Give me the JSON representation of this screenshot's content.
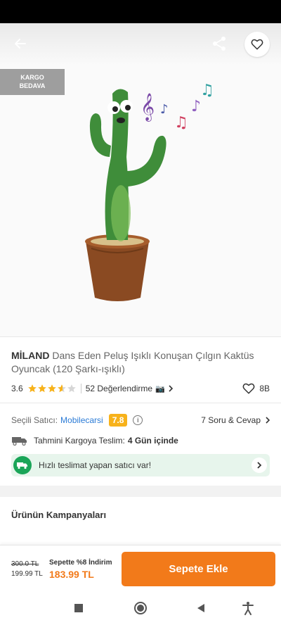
{
  "badge": {
    "line1": "KARGO",
    "line2": "BEDAVA"
  },
  "product": {
    "brand": "MİLAND",
    "name": "Dans Eden Peluş Işıklı Konuşan Çılgın Kaktüs Oyuncak (120 Şarkı-ışıklı)"
  },
  "rating": {
    "value": "3.6",
    "stars_filled": 3.6,
    "stars_total": 5,
    "reviews": "52 Değerlendirme",
    "favorites": "8B"
  },
  "seller": {
    "label": "Seçili Satıcı:",
    "name": "Mobilecarsi",
    "score": "7.8",
    "qa": "7 Soru & Cevap"
  },
  "shipping": {
    "label": "Tahmini Kargoya Teslim:",
    "value": "4 Gün içinde",
    "fast_text": "Hızlı teslimat yapan satıcı var!"
  },
  "campaigns": {
    "title": "Ürünün Kampanyaları"
  },
  "price": {
    "old": "300.0 TL",
    "list": "199.99 TL",
    "cart_discount": "Sepette %8 İndirim",
    "final": "183.99 TL",
    "add_to_cart": "Sepete Ekle"
  },
  "colors": {
    "accent": "#f27a1a",
    "seller_link": "#2b7bd6",
    "score_bg": "#f7b21b",
    "fast_green": "#1aa558",
    "star": "#f7b21b"
  }
}
